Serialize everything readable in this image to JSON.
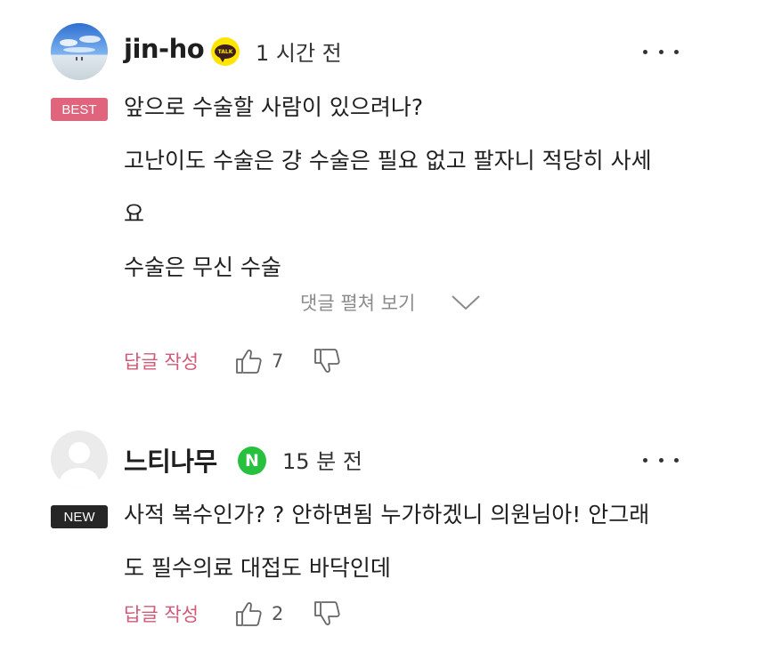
{
  "comments": [
    {
      "username": "jin-ho",
      "provider": "kakao",
      "provider_badge_text": "TALK",
      "time": "1 시간 전",
      "tag": "BEST",
      "lines": [
        "앞으로 수술할 사람이 있으려나?",
        "고난이도 수술은 걍 수술은 필요 없고 팔자니 적당히 사세",
        "요",
        "수술은 무신 수술"
      ],
      "expand_label": "댓글 펼쳐 보기",
      "reply_label": "답글 작성",
      "likes": "7"
    },
    {
      "username": "느티나무",
      "provider": "naver",
      "provider_badge_text": "N",
      "time": "15 분 전",
      "tag": "NEW",
      "lines": [
        "사적 복수인가? ? 안하면됨 누가하겠니 의원님아! 안그래",
        "도 필수의료 대접도 바닥인데"
      ],
      "reply_label": "답글 작성",
      "likes": "2"
    }
  ],
  "colors": {
    "best_tag": "#e0647b",
    "new_tag": "#262626",
    "reply": "#d05a77",
    "kakao": "#fee500",
    "naver": "#27c13e"
  },
  "icons": [
    "more-icon",
    "thumbs-up-icon",
    "thumbs-down-icon",
    "chevron-down-icon",
    "kakao-talk-icon",
    "naver-icon"
  ]
}
